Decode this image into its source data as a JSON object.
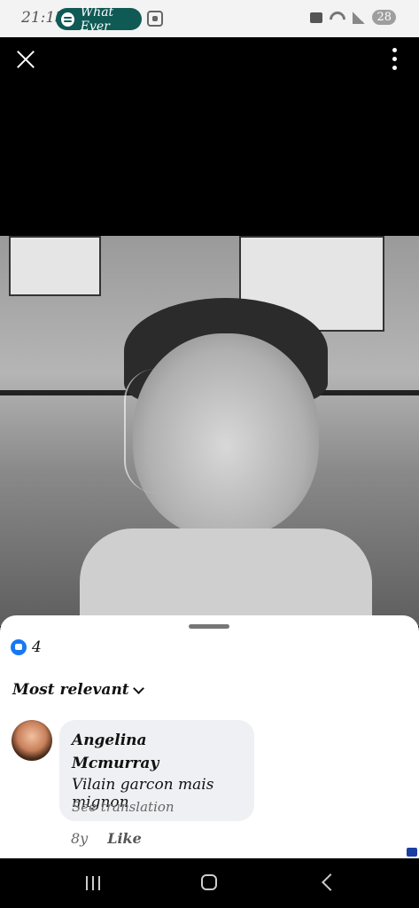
{
  "status_bar": {
    "time": "21:13",
    "media_title": "What Ever",
    "battery": "28"
  },
  "reactions": {
    "count": "4"
  },
  "comments_filter": {
    "label": "Most relevant"
  },
  "comment": {
    "author": "Angelina Mcmurray",
    "text": "Vilain garcon mais mignon",
    "translate_label": "See translation",
    "time_ago": "8y",
    "like_label": "Like"
  }
}
